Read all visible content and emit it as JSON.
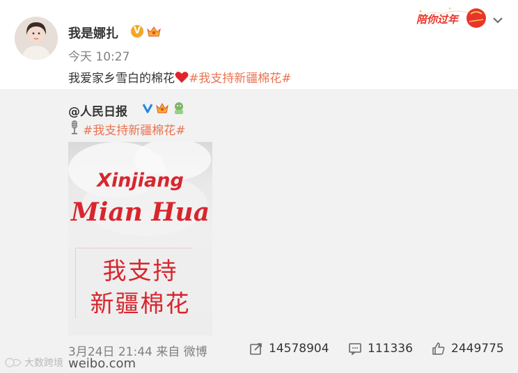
{
  "post": {
    "author_name": "我是娜扎",
    "verified_badge": "V",
    "time": "今天 10:27",
    "text": "我爱家乡雪白的棉花",
    "hashtag": "#我支持新疆棉花#",
    "festival_badge": "陪你过年"
  },
  "repost": {
    "author": "@人民日报",
    "hashtag": "#我支持新疆棉花#",
    "image_text": {
      "line1": "Xinjiang",
      "line2": "Mian Hua",
      "cn_line1": "我支持",
      "cn_line2": "新疆棉花"
    },
    "meta": "3月24日 21:44 来自 微博",
    "reposts": "14578904",
    "comments": "111336",
    "likes": "2449775"
  },
  "watermark": {
    "brand": "大数跨境",
    "url": "weibo.com"
  },
  "colors": {
    "hashtag": "#eb7350",
    "repost_bg": "#f2f2f2",
    "image_red": "#d8262e"
  }
}
